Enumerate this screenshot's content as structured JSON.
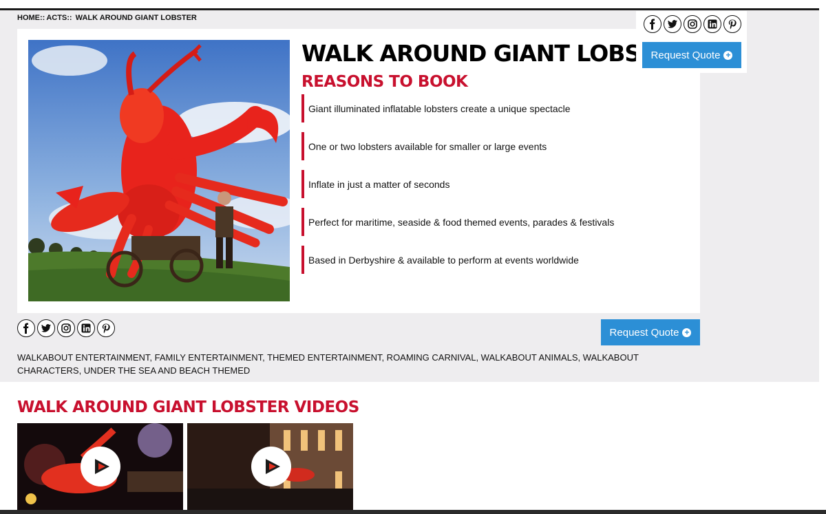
{
  "breadcrumb": {
    "home": "HOME::",
    "acts": "ACTS::",
    "current": "WALK AROUND GIANT LOBSTER"
  },
  "act": {
    "title": "WALK AROUND GIANT LOBSTER",
    "reasons_heading": "REASONS TO BOOK",
    "reasons": [
      "Giant illuminated inflatable lobsters create a unique spectacle",
      "One or two lobsters available for smaller or large events",
      "Inflate in just a matter of seconds",
      "Perfect for maritime, seaside & food themed events, parades & festivals",
      "Based in Derbyshire & available to perform at events worldwide"
    ]
  },
  "social": {
    "icons": [
      "facebook-icon",
      "twitter-icon",
      "instagram-icon",
      "linkedin-icon",
      "pinterest-icon"
    ]
  },
  "buttons": {
    "request_quote": "Request Quote"
  },
  "tags": "WALKABOUT ENTERTAINMENT, FAMILY ENTERTAINMENT, THEMED ENTERTAINMENT, ROAMING CARNIVAL, WALKABOUT ANIMALS, WALKABOUT CHARACTERS, UNDER THE SEA AND BEACH THEMED",
  "videos": {
    "heading": "WALK AROUND GIANT LOBSTER VIDEOS"
  },
  "colors": {
    "accent_red": "#c8102e",
    "button_blue": "#2c8fd6",
    "page_bg": "#eeedef"
  }
}
